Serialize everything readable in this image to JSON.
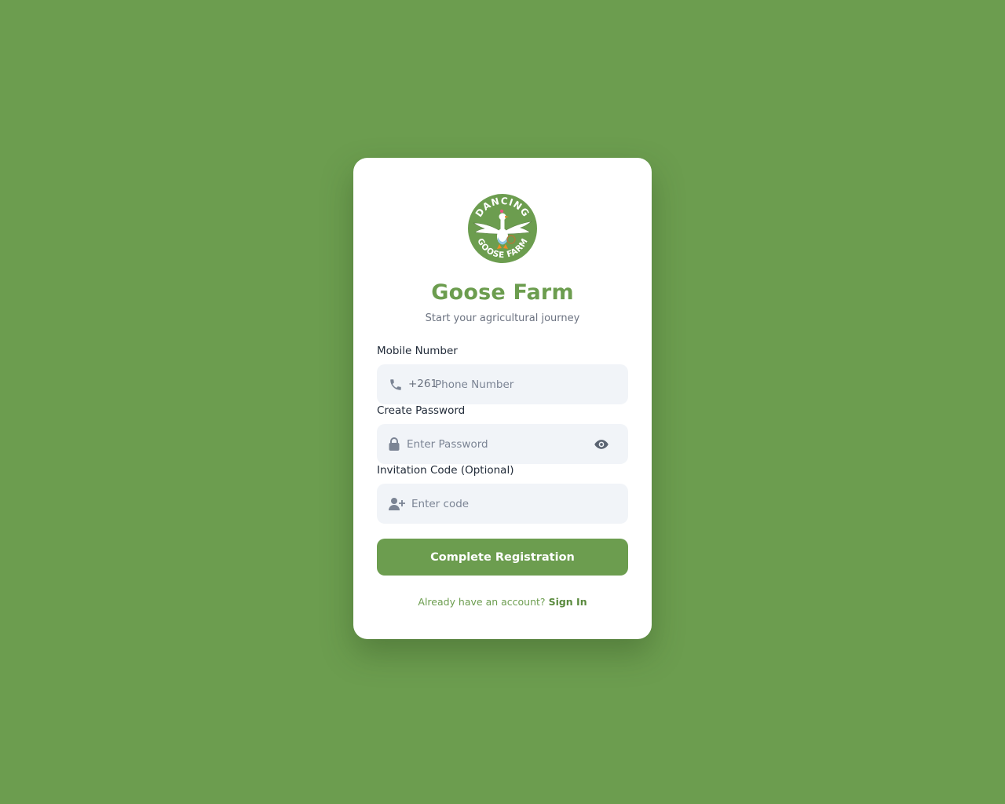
{
  "brand": {
    "logo_text_top": "DANCING",
    "logo_text_bottom": "GOOSE FARM",
    "title": "Goose Farm",
    "subtitle": "Start your agricultural journey"
  },
  "form": {
    "mobile": {
      "label": "Mobile Number",
      "prefix": "+261",
      "placeholder": "Phone Number",
      "icon": "phone-icon"
    },
    "password": {
      "label": "Create Password",
      "placeholder": "Enter Password",
      "icon": "lock-icon",
      "toggle_icon": "eye-icon"
    },
    "invite": {
      "label": "Invitation Code (Optional)",
      "placeholder": "Enter code",
      "icon": "user-plus-icon"
    },
    "submit_label": "Complete Registration"
  },
  "footer": {
    "prompt": "Already have an account?",
    "link_label": "Sign In"
  },
  "colors": {
    "background": "#6c9d4f",
    "brand": "#6c9d4f",
    "field_bg": "#f1f4f8",
    "card": "#ffffff"
  }
}
